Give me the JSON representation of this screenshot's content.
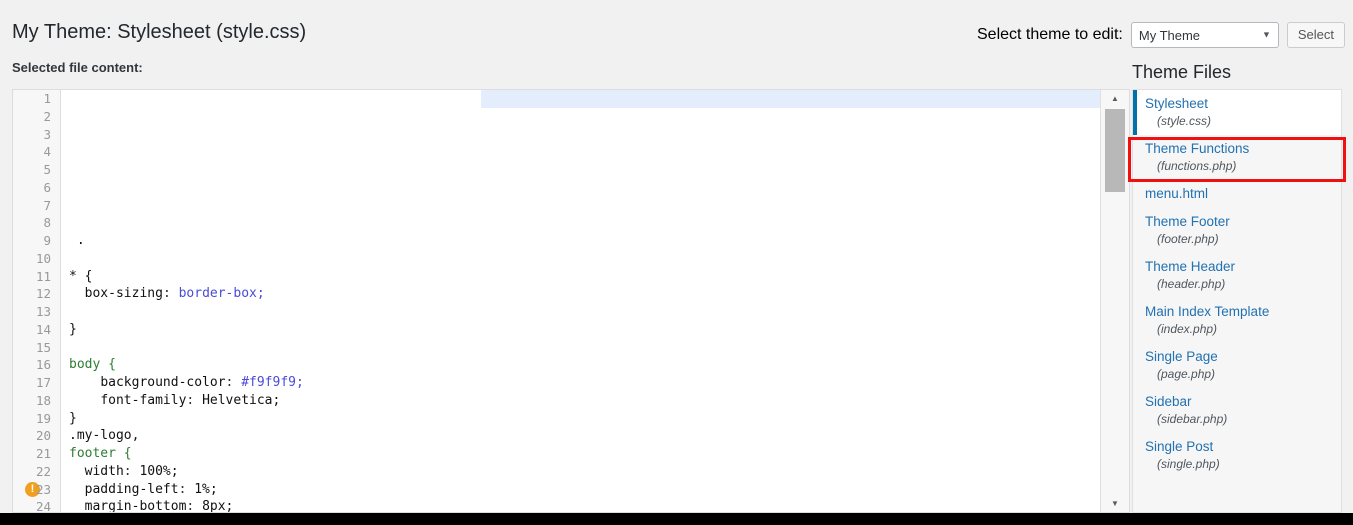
{
  "header": {
    "page_title": "My Theme: Stylesheet (style.css)",
    "select_theme_label": "Select theme to edit:",
    "theme_select_value": "My Theme",
    "theme_select_caret": "chevron-down-icon",
    "select_button_label": "Select",
    "selected_file_label": "Selected file content:"
  },
  "editor": {
    "lines": [
      {
        "n": "1",
        "code": "",
        "selected": true
      },
      {
        "n": "2",
        "code": ""
      },
      {
        "n": "3",
        "code": ""
      },
      {
        "n": "4",
        "code": ""
      },
      {
        "n": "5",
        "code": ""
      },
      {
        "n": "6",
        "code": ""
      },
      {
        "n": "7",
        "code": ""
      },
      {
        "n": "8",
        "code": ""
      },
      {
        "n": "9",
        "code": " ."
      },
      {
        "n": "10",
        "code": ""
      },
      {
        "n": "11",
        "code": "* {"
      },
      {
        "n": "12",
        "code": "  box-sizing: border-box;"
      },
      {
        "n": "13",
        "code": ""
      },
      {
        "n": "14",
        "code": "}"
      },
      {
        "n": "15",
        "code": ""
      },
      {
        "n": "16",
        "code": "body {"
      },
      {
        "n": "17",
        "code": "    background-color: #f9f9f9;"
      },
      {
        "n": "18",
        "code": "    font-family: Helvetica;"
      },
      {
        "n": "19",
        "code": "}"
      },
      {
        "n": "20",
        "code": ".my-logo,"
      },
      {
        "n": "21",
        "code": "footer {"
      },
      {
        "n": "22",
        "code": "  width: 100%;"
      },
      {
        "n": "23",
        "code": "  padding-left: 1%;",
        "warning": true
      },
      {
        "n": "24",
        "code": "  margin-bottom: 8px;"
      }
    ],
    "scrollbar": {
      "up_arrow": "triangle-up-icon",
      "down_arrow": "triangle-down-icon"
    }
  },
  "theme_files": {
    "title": "Theme Files",
    "items": [
      {
        "title": "Stylesheet",
        "sub": "(style.css)",
        "active": true
      },
      {
        "title": "Theme Functions",
        "sub": "(functions.php)",
        "highlighted": true
      },
      {
        "title": "menu.html",
        "sub": ""
      },
      {
        "title": "Theme Footer",
        "sub": "(footer.php)"
      },
      {
        "title": "Theme Header",
        "sub": "(header.php)"
      },
      {
        "title": "Main Index Template",
        "sub": "(index.php)"
      },
      {
        "title": "Single Page",
        "sub": "(page.php)"
      },
      {
        "title": "Sidebar",
        "sub": "(sidebar.php)"
      },
      {
        "title": "Single Post",
        "sub": "(single.php)"
      }
    ]
  },
  "colors": {
    "link": "#2271b1",
    "active_marker": "#0073aa",
    "highlight_box": "#ef1010",
    "warning": "#f0a01e",
    "selection": "#e3edfb"
  }
}
